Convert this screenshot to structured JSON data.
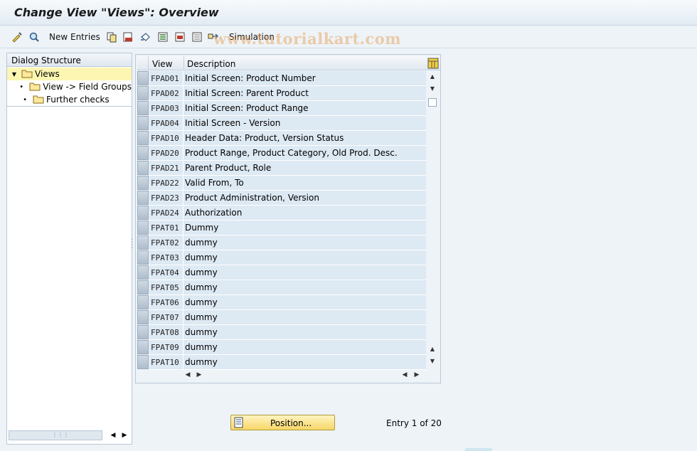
{
  "title": "Change View \"Views\": Overview",
  "toolbar": {
    "new_entries": "New Entries",
    "simulation": "Simulation",
    "icons": [
      "display-change-icon",
      "find-icon",
      "copy-icon",
      "delete-icon",
      "undo-icon",
      "select-all-icon",
      "select-block-icon",
      "deselect-all-icon",
      "configuration-icon"
    ]
  },
  "watermark": "www.tutorialkart.com",
  "dialog": {
    "header": "Dialog Structure",
    "items": [
      {
        "label": "Views",
        "selected": true
      },
      {
        "label": "View -> Field Groups",
        "selected": false
      },
      {
        "label": "Further checks",
        "selected": false
      }
    ]
  },
  "table": {
    "columns": [
      "View",
      "Description"
    ],
    "rows": [
      {
        "view": "FPAD01",
        "desc": "Initial Screen: Product Number"
      },
      {
        "view": "FPAD02",
        "desc": "Initial Screen: Parent Product"
      },
      {
        "view": "FPAD03",
        "desc": "Initial Screen: Product Range"
      },
      {
        "view": "FPAD04",
        "desc": "Initial Screen - Version"
      },
      {
        "view": "FPAD10",
        "desc": "Header Data: Product, Version Status"
      },
      {
        "view": "FPAD20",
        "desc": "Product Range, Product Category, Old Prod. Desc."
      },
      {
        "view": "FPAD21",
        "desc": "Parent Product, Role"
      },
      {
        "view": "FPAD22",
        "desc": "Valid From, To"
      },
      {
        "view": "FPAD23",
        "desc": "Product Administration, Version"
      },
      {
        "view": "FPAD24",
        "desc": "Authorization"
      },
      {
        "view": "FPAT01",
        "desc": "Dummy"
      },
      {
        "view": "FPAT02",
        "desc": "dummy"
      },
      {
        "view": "FPAT03",
        "desc": "dummy"
      },
      {
        "view": "FPAT04",
        "desc": "dummy"
      },
      {
        "view": "FPAT05",
        "desc": "dummy"
      },
      {
        "view": "FPAT06",
        "desc": "dummy"
      },
      {
        "view": "FPAT07",
        "desc": "dummy"
      },
      {
        "view": "FPAT08",
        "desc": "dummy"
      },
      {
        "view": "FPAT09",
        "desc": "dummy"
      },
      {
        "view": "FPAT10",
        "desc": "dummy"
      }
    ]
  },
  "position_button": "Position...",
  "entry_text": "Entry 1 of 20",
  "colors": {
    "row_bg": "#dde9f3",
    "selected_tree": "#fdf6b3",
    "button": "#f7d768"
  }
}
